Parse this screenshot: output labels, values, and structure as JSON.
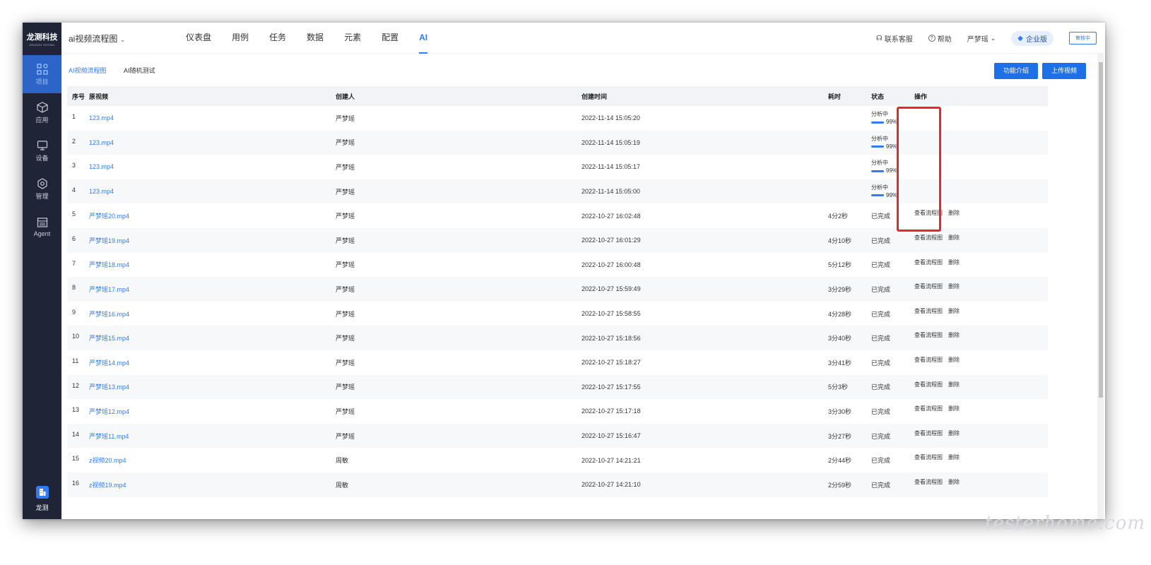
{
  "sidebar": {
    "logo_line1": "龙测科技",
    "logo_line2": "DRAGON TESTING",
    "items": [
      {
        "label": "项目",
        "icon": "grid-icon"
      },
      {
        "label": "应用",
        "icon": "box-icon"
      },
      {
        "label": "设备",
        "icon": "monitor-icon"
      },
      {
        "label": "管理",
        "icon": "settings-icon"
      },
      {
        "label": "Agent",
        "icon": "agent-icon"
      }
    ],
    "bottom_label": "龙测"
  },
  "header": {
    "project": "ai视频流程图",
    "nav": [
      "仪表盘",
      "用例",
      "任务",
      "数据",
      "元素",
      "配置",
      "AI"
    ],
    "active_nav": "AI",
    "support": "联系客服",
    "help": "帮助",
    "user": "严梦瑶",
    "edition": "企业版",
    "audit": "审核中"
  },
  "breadcrumb": {
    "first": "AI视频流程图",
    "second": "AI随机测试"
  },
  "buttons": {
    "intro": "功能介绍",
    "upload": "上传视频"
  },
  "table": {
    "headers": [
      "序号",
      "原视频",
      "创建人",
      "创建时间",
      "耗时",
      "状态",
      "操作"
    ],
    "rows": [
      {
        "idx": "1",
        "video": "123.mp4",
        "creator": "严梦瑶",
        "time": "2022-11-14 15:05:20",
        "duration": "",
        "status": "分析中",
        "progress": "99%",
        "ops": []
      },
      {
        "idx": "2",
        "video": "123.mp4",
        "creator": "严梦瑶",
        "time": "2022-11-14 15:05:19",
        "duration": "",
        "status": "分析中",
        "progress": "99%",
        "ops": []
      },
      {
        "idx": "3",
        "video": "123.mp4",
        "creator": "严梦瑶",
        "time": "2022-11-14 15:05:17",
        "duration": "",
        "status": "分析中",
        "progress": "99%",
        "ops": []
      },
      {
        "idx": "4",
        "video": "123.mp4",
        "creator": "严梦瑶",
        "time": "2022-11-14 15:05:00",
        "duration": "",
        "status": "分析中",
        "progress": "99%",
        "ops": []
      },
      {
        "idx": "5",
        "video": "严梦瑶20.mp4",
        "creator": "严梦瑶",
        "time": "2022-10-27 16:02:48",
        "duration": "4分2秒",
        "status": "已完成",
        "progress": "",
        "ops": [
          "查看流程图",
          "删除"
        ]
      },
      {
        "idx": "6",
        "video": "严梦瑶19.mp4",
        "creator": "严梦瑶",
        "time": "2022-10-27 16:01:29",
        "duration": "4分10秒",
        "status": "已完成",
        "progress": "",
        "ops": [
          "查看流程图",
          "删除"
        ]
      },
      {
        "idx": "7",
        "video": "严梦瑶18.mp4",
        "creator": "严梦瑶",
        "time": "2022-10-27 16:00:48",
        "duration": "5分12秒",
        "status": "已完成",
        "progress": "",
        "ops": [
          "查看流程图",
          "删除"
        ]
      },
      {
        "idx": "8",
        "video": "严梦瑶17.mp4",
        "creator": "严梦瑶",
        "time": "2022-10-27 15:59:49",
        "duration": "3分29秒",
        "status": "已完成",
        "progress": "",
        "ops": [
          "查看流程图",
          "删除"
        ]
      },
      {
        "idx": "9",
        "video": "严梦瑶16.mp4",
        "creator": "严梦瑶",
        "time": "2022-10-27 15:58:55",
        "duration": "4分28秒",
        "status": "已完成",
        "progress": "",
        "ops": [
          "查看流程图",
          "删除"
        ]
      },
      {
        "idx": "10",
        "video": "严梦瑶15.mp4",
        "creator": "严梦瑶",
        "time": "2022-10-27 15:18:56",
        "duration": "3分40秒",
        "status": "已完成",
        "progress": "",
        "ops": [
          "查看流程图",
          "删除"
        ]
      },
      {
        "idx": "11",
        "video": "严梦瑶14.mp4",
        "creator": "严梦瑶",
        "time": "2022-10-27 15:18:27",
        "duration": "3分41秒",
        "status": "已完成",
        "progress": "",
        "ops": [
          "查看流程图",
          "删除"
        ]
      },
      {
        "idx": "12",
        "video": "严梦瑶13.mp4",
        "creator": "严梦瑶",
        "time": "2022-10-27 15:17:55",
        "duration": "5分3秒",
        "status": "已完成",
        "progress": "",
        "ops": [
          "查看流程图",
          "删除"
        ]
      },
      {
        "idx": "13",
        "video": "严梦瑶12.mp4",
        "creator": "严梦瑶",
        "time": "2022-10-27 15:17:18",
        "duration": "3分30秒",
        "status": "已完成",
        "progress": "",
        "ops": [
          "查看流程图",
          "删除"
        ]
      },
      {
        "idx": "14",
        "video": "严梦瑶11.mp4",
        "creator": "严梦瑶",
        "time": "2022-10-27 15:16:47",
        "duration": "3分27秒",
        "status": "已完成",
        "progress": "",
        "ops": [
          "查看流程图",
          "删除"
        ]
      },
      {
        "idx": "15",
        "video": "z视频20.mp4",
        "creator": "周敏",
        "time": "2022-10-27 14:21:21",
        "duration": "2分44秒",
        "status": "已完成",
        "progress": "",
        "ops": [
          "查看流程图",
          "删除"
        ]
      },
      {
        "idx": "16",
        "video": "z视频19.mp4",
        "creator": "周敏",
        "time": "2022-10-27 14:21:10",
        "duration": "2分59秒",
        "status": "已完成",
        "progress": "",
        "ops": [
          "查看流程图",
          "删除"
        ]
      }
    ]
  },
  "watermark": "testerhome.com",
  "colors": {
    "accent": "#2f7cf6",
    "sidebar": "#1f2436",
    "highlight": "#e8262c"
  }
}
